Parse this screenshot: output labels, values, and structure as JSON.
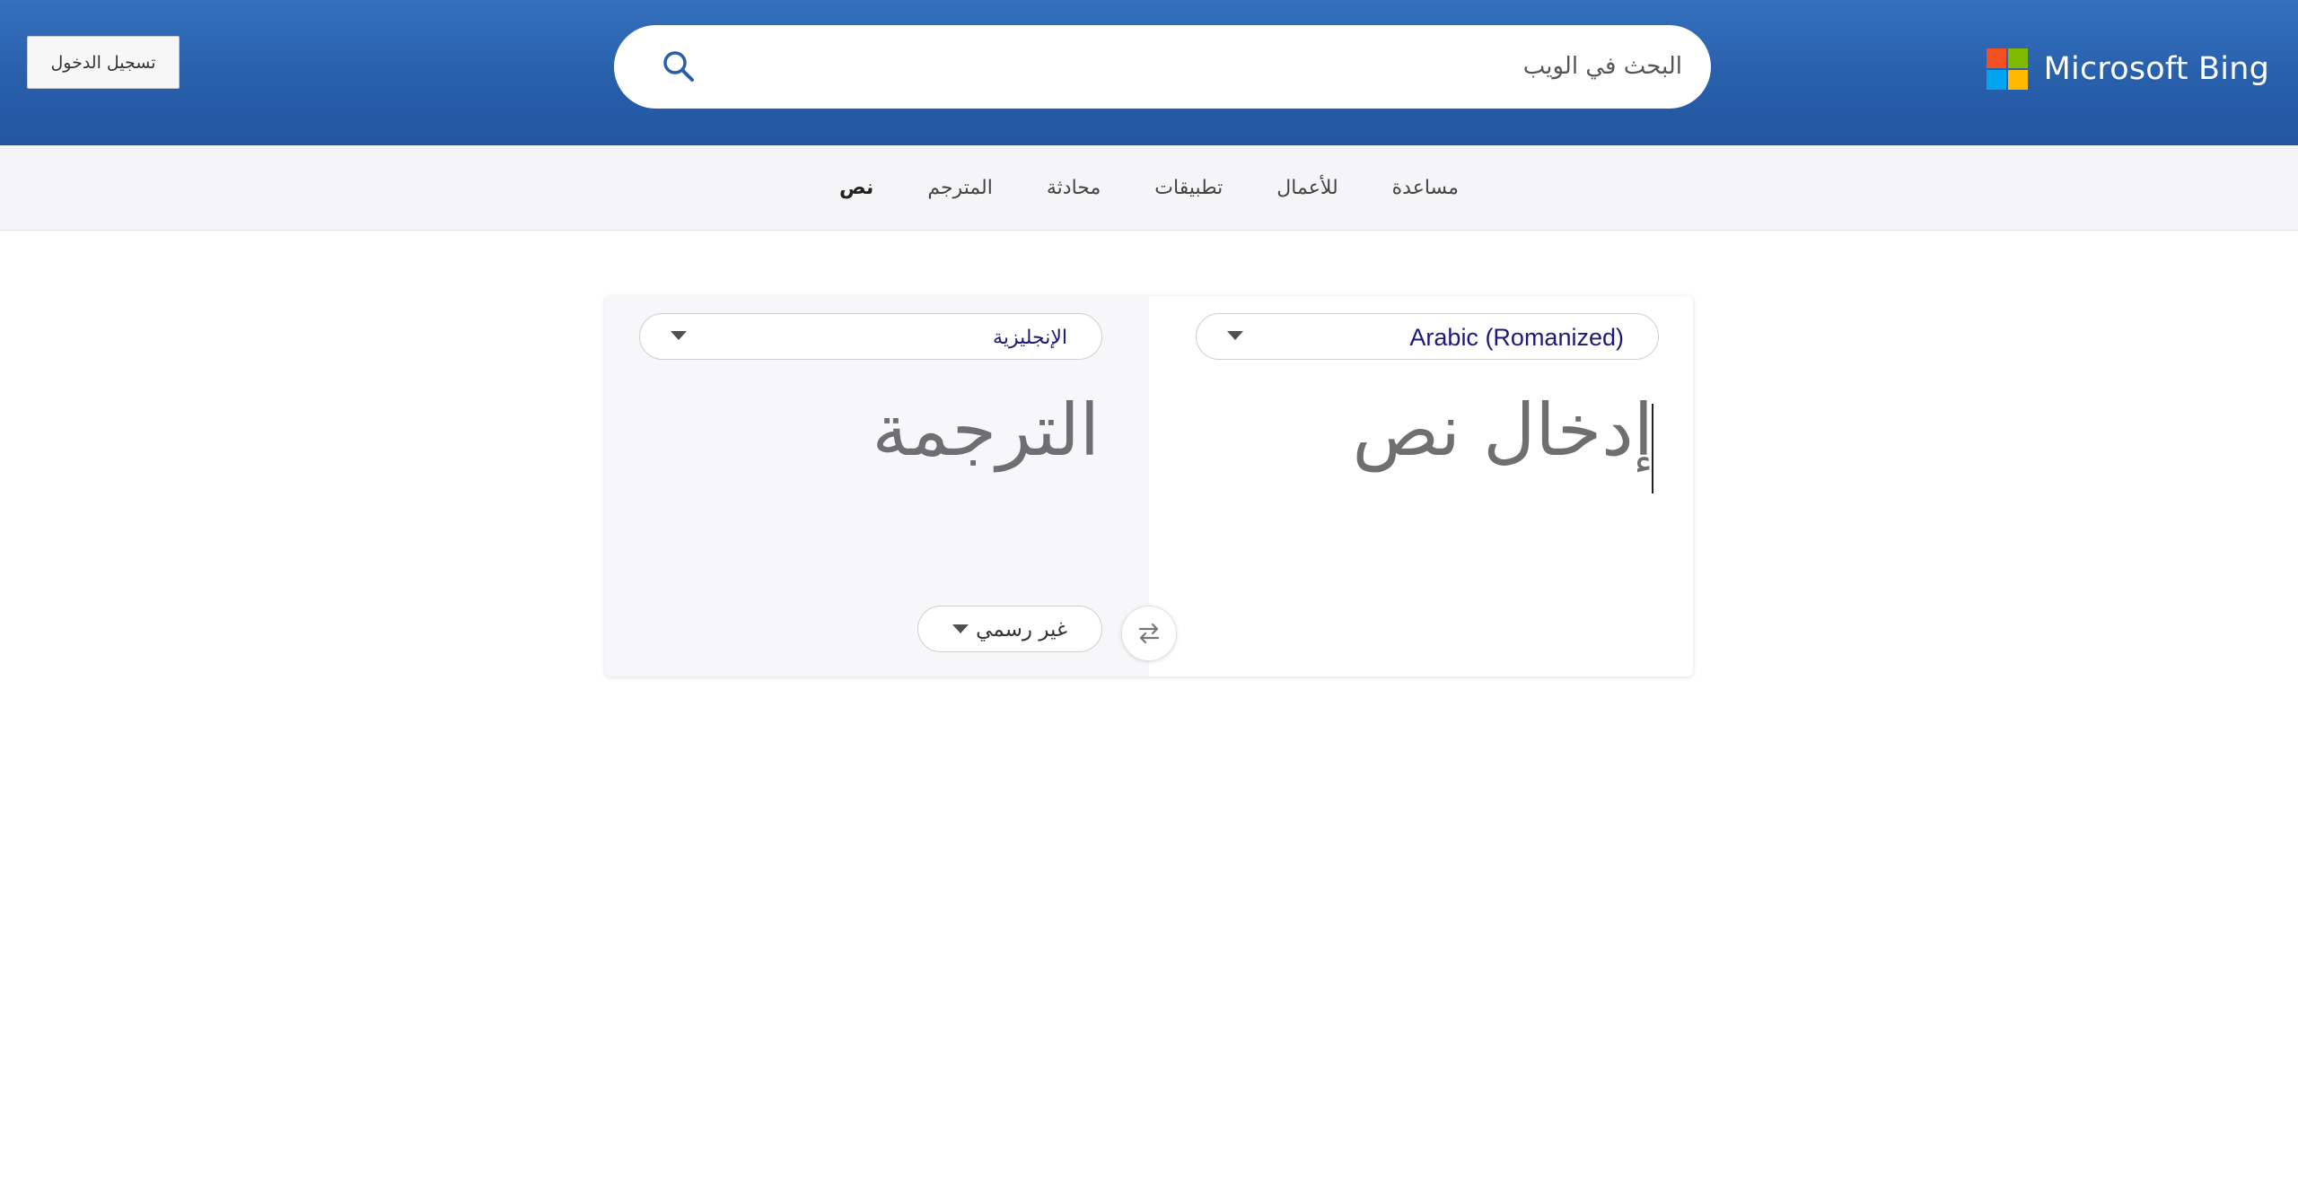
{
  "header": {
    "brand": "Microsoft Bing",
    "signin_label": "تسجيل الدخول",
    "search": {
      "placeholder": "البحث في الويب",
      "value": ""
    },
    "logo_colors": [
      "#f25022",
      "#7fba00",
      "#00a4ef",
      "#ffb900"
    ]
  },
  "nav": {
    "items": [
      {
        "label": "نص",
        "active": true
      },
      {
        "label": "المترجم",
        "active": false
      },
      {
        "label": "محادثة",
        "active": false
      },
      {
        "label": "تطبيقات",
        "active": false
      },
      {
        "label": "للأعمال",
        "active": false
      },
      {
        "label": "مساعدة",
        "active": false
      }
    ]
  },
  "translator": {
    "source_language": "Arabic (Romanized)",
    "target_language": "الإنجليزية",
    "source_placeholder": "إدخال نص",
    "target_placeholder": "الترجمة",
    "tone": "غير رسمي"
  },
  "colors": {
    "header_blue": "#2b63af",
    "language_text": "#1a1a7a",
    "search_icon": "#2a5fa8"
  }
}
